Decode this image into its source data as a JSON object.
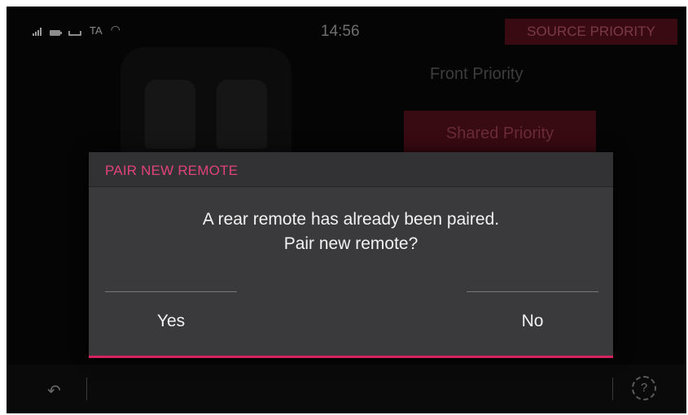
{
  "status_bar": {
    "icons": [
      "signal-icon",
      "battery-icon",
      "phone-icon",
      "wifi-icon"
    ],
    "ta_label": "TA",
    "time": "14:56",
    "source_priority_label": "SOURCE PRIORITY"
  },
  "background": {
    "options": [
      "Front Priority",
      "Shared Priority"
    ],
    "selected": "Shared Priority"
  },
  "dialog": {
    "title": "PAIR NEW REMOTE",
    "message_line1": "A rear remote has already been paired.",
    "message_line2": "Pair new remote?",
    "yes_label": "Yes",
    "no_label": "No"
  },
  "bottom_bar": {
    "icons": [
      "back-icon",
      "help-icon"
    ]
  },
  "colors": {
    "accent": "#d4235e",
    "title": "#e0427a",
    "dialog_bg": "#3a3a3c"
  }
}
